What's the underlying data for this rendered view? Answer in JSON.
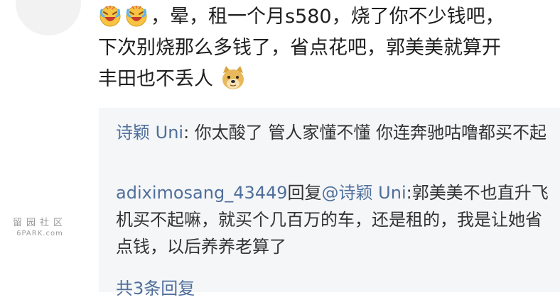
{
  "comment": {
    "emojis": [
      "laughing-cry-face-icon",
      "laughing-cry-face-icon"
    ],
    "text_line1": "，晕，租一个月s580，烧了你不少钱吧，",
    "text_line2": "下次别烧那么多钱了，省点花吧，郭美美就算开",
    "text_line3": "丰田也不丢人",
    "end_emoji": "doge-face-icon"
  },
  "replies": [
    {
      "user": "诗颖 Uni",
      "separator": ": ",
      "text": "你太酸了 管人家懂不懂 你连奔驰咕噜都买不起"
    },
    {
      "user": "adiximosang_43449",
      "reply_word": "回复",
      "mention": "@诗颖 Uni",
      "separator": ":",
      "text": "郭美美不也直升飞机买不起嘛，就买个几百万的车，还是租的，我是让她省点钱，以后养养老算了"
    }
  ],
  "more_replies": "共3条回复",
  "watermark": {
    "cn": "留园社区",
    "en": "6PARK.com"
  },
  "colors": {
    "link": "#4f6f9b",
    "reply_background": "#f5f6f8"
  }
}
